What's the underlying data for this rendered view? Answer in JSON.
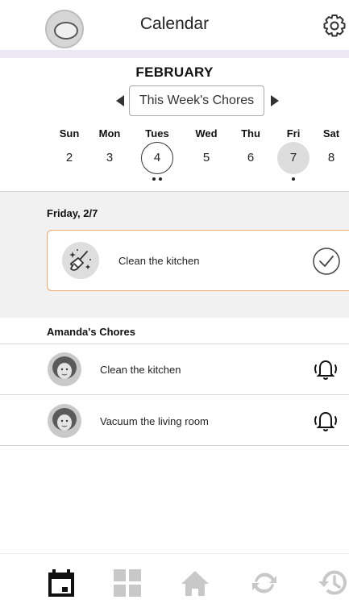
{
  "header": {
    "title": "Calendar"
  },
  "calendar": {
    "month": "FEBRUARY",
    "week_label": "This Week's Chores",
    "days": [
      {
        "name": "Sun",
        "num": "2"
      },
      {
        "name": "Mon",
        "num": "3"
      },
      {
        "name": "Tues",
        "num": "4"
      },
      {
        "name": "Wed",
        "num": "5"
      },
      {
        "name": "Thu",
        "num": "6"
      },
      {
        "name": "Fri",
        "num": "7"
      },
      {
        "name": "Sat",
        "num": "8"
      }
    ],
    "selected_day": "Tues 4",
    "today": "Fri 7"
  },
  "day_panel": {
    "label": "Friday, 2/7",
    "chore": {
      "title": "Clean the kitchen",
      "icon": "broom-sparkle-icon",
      "status_icon": "check-circle-icon"
    }
  },
  "amanda": {
    "title": "Amanda's Chores",
    "items": [
      {
        "title": "Clean the kitchen",
        "icon": "bell-icon"
      },
      {
        "title": "Vacuum the living room",
        "icon": "bell-icon"
      }
    ]
  },
  "nav": {
    "items": [
      "calendar-icon",
      "dashboard-grid-icon",
      "home-icon",
      "sync-icon",
      "history-icon"
    ]
  },
  "colors": {
    "accent_border": "#f0a86a",
    "panel_bg": "#f1f1f1",
    "header_strip": "#ece8f3"
  }
}
